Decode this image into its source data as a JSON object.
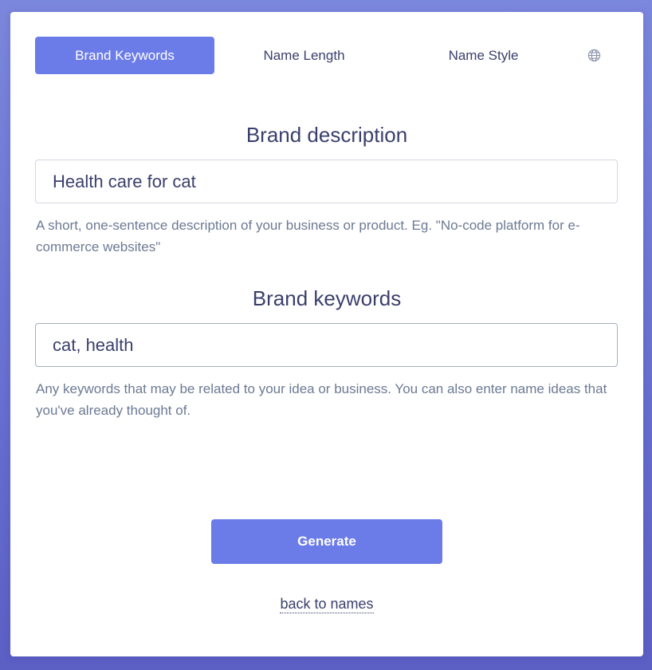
{
  "tabs": [
    {
      "label": "Brand Keywords",
      "active": true
    },
    {
      "label": "Name Length",
      "active": false
    },
    {
      "label": "Name Style",
      "active": false
    }
  ],
  "language_icon": "globe-icon",
  "description": {
    "title": "Brand description",
    "value": "Health care for cat",
    "help": "A short, one-sentence description of your business or product. Eg. \"No-code platform for e-commerce websites\""
  },
  "keywords": {
    "title": "Brand keywords",
    "value": "cat, health",
    "help": "Any keywords that may be related to your idea or business. You can also enter name ideas that you've already thought of."
  },
  "generate_label": "Generate",
  "back_label": "back to names",
  "colors": {
    "accent": "#6b7be8",
    "text": "#3a3f6b",
    "muted": "#6c7a93"
  }
}
